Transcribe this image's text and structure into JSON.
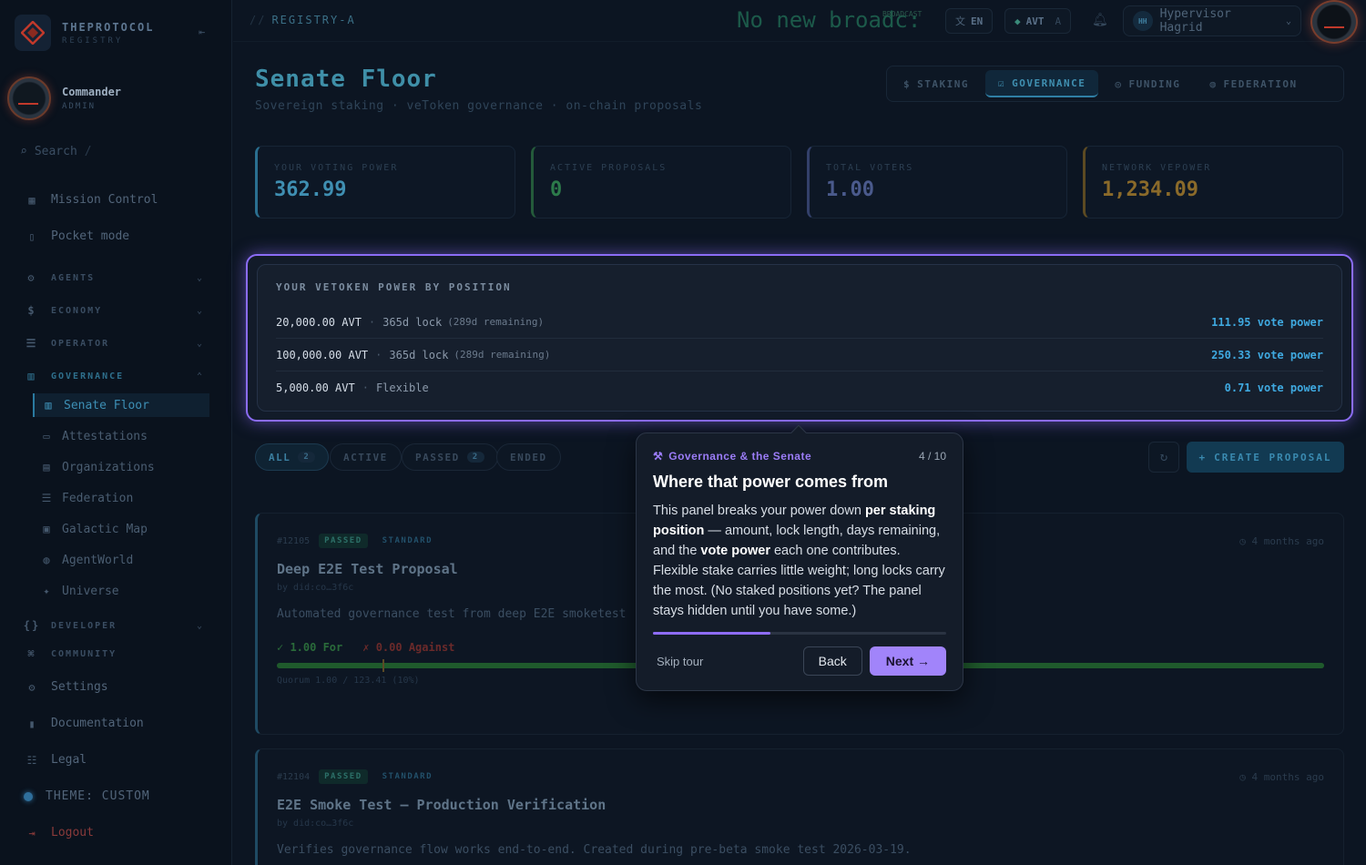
{
  "brand": {
    "name": "THEPROTOCOL",
    "sub": "REGISTRY"
  },
  "user": {
    "name": "Commander",
    "role": "ADMIN"
  },
  "search": {
    "placeholder": "Search",
    "shortcut": "/"
  },
  "sidebar": {
    "top_items": [
      {
        "label": "Mission Control",
        "icon": "grid-icon"
      },
      {
        "label": "Pocket mode",
        "icon": "phone-icon"
      }
    ],
    "groups": [
      {
        "label": "AGENTS"
      },
      {
        "label": "ECONOMY"
      },
      {
        "label": "OPERATOR"
      },
      {
        "label": "GOVERNANCE"
      }
    ],
    "governance_items": [
      {
        "label": "Senate Floor",
        "active": true
      },
      {
        "label": "Attestations"
      },
      {
        "label": "Organizations"
      },
      {
        "label": "Federation"
      },
      {
        "label": "Galactic Map"
      },
      {
        "label": "AgentWorld"
      },
      {
        "label": "Universe"
      }
    ],
    "developer_label": "DEVELOPER",
    "community_label": "COMMUNITY",
    "bottom_items": [
      {
        "label": "Settings"
      },
      {
        "label": "Documentation"
      },
      {
        "label": "Legal"
      },
      {
        "label": "THEME: CUSTOM"
      },
      {
        "label": "Logout"
      }
    ]
  },
  "topbar": {
    "breadcrumb_sep": "//",
    "breadcrumb": "REGISTRY-A",
    "ticker": "No new broadc:",
    "ticker_tag": "BROADCAST",
    "lang": "EN",
    "currency": "AVT",
    "currency_tag": "A",
    "account": "Hypervisor Hagrid",
    "account_badge": "HH"
  },
  "page": {
    "title": "Senate Floor",
    "subtitle": "Sovereign staking · veToken governance · on-chain proposals"
  },
  "tabs": [
    {
      "label": "STAKING",
      "icon": "$"
    },
    {
      "label": "GOVERNANCE",
      "icon": "☑",
      "active": true
    },
    {
      "label": "FUNDING",
      "icon": "◎"
    },
    {
      "label": "FEDERATION",
      "icon": "◍"
    }
  ],
  "stats": [
    {
      "label": "YOUR VOTING POWER",
      "value": "362.99",
      "color": "#3f8fb2"
    },
    {
      "label": "ACTIVE PROPOSALS",
      "value": "0",
      "color": "#2c7a4a"
    },
    {
      "label": "TOTAL VOTERS",
      "value": "1.00",
      "color": "#4a5a8c"
    },
    {
      "label": "NETWORK VEPOWER",
      "value": "1,234.09",
      "color": "#8a6a2a"
    }
  ],
  "ve_panel": {
    "title": "YOUR VETOKEN POWER BY POSITION",
    "rows": [
      {
        "amount": "20,000.00 AVT",
        "lock": "365d lock",
        "remaining": "(289d remaining)",
        "power": "111.95 vote power"
      },
      {
        "amount": "100,000.00 AVT",
        "lock": "365d lock",
        "remaining": "(289d remaining)",
        "power": "250.33 vote power"
      },
      {
        "amount": "5,000.00 AVT",
        "lock": "Flexible",
        "remaining": "",
        "power": "0.71 vote power"
      }
    ]
  },
  "filters": [
    {
      "label": "ALL",
      "count": "2",
      "active": true
    },
    {
      "label": "ACTIVE",
      "count": ""
    },
    {
      "label": "PASSED",
      "count": "2"
    },
    {
      "label": "ENDED",
      "count": ""
    }
  ],
  "create_label": "CREATE PROPOSAL",
  "proposals": [
    {
      "id": "#12105",
      "status": "PASSED",
      "type": "STANDARD",
      "ago": "4 months ago",
      "title": "Deep E2E Test Proposal",
      "by": "by did:co…3f6c",
      "desc": "Automated governance test from deep E2E smoketest",
      "for": "✓ 1.00 For",
      "against": "✗ 0.00 Against",
      "quorum": "Quorum 1.00 / 123.41 (10%)"
    },
    {
      "id": "#12104",
      "status": "PASSED",
      "type": "STANDARD",
      "ago": "4 months ago",
      "title": "E2E Smoke Test — Production Verification",
      "by": "by did:co…3f6c",
      "desc": "Verifies governance flow works end-to-end. Created during pre-beta smoke test 2026-03-19."
    }
  ],
  "tour": {
    "section": "Governance & the Senate",
    "step": "4 / 10",
    "progress": 0.4,
    "title": "Where that power comes from",
    "body_1": "This panel breaks your power down ",
    "body_b1": "per staking position",
    "body_2": " — amount, lock length, days remaining, and the ",
    "body_b2": "vote power",
    "body_3": " each one contributes. Flexible stake carries little weight; long locks carry the most. (No staked positions yet? The panel stays hidden until you have some.)",
    "skip": "Skip tour",
    "back": "Back",
    "next": "Next →"
  }
}
